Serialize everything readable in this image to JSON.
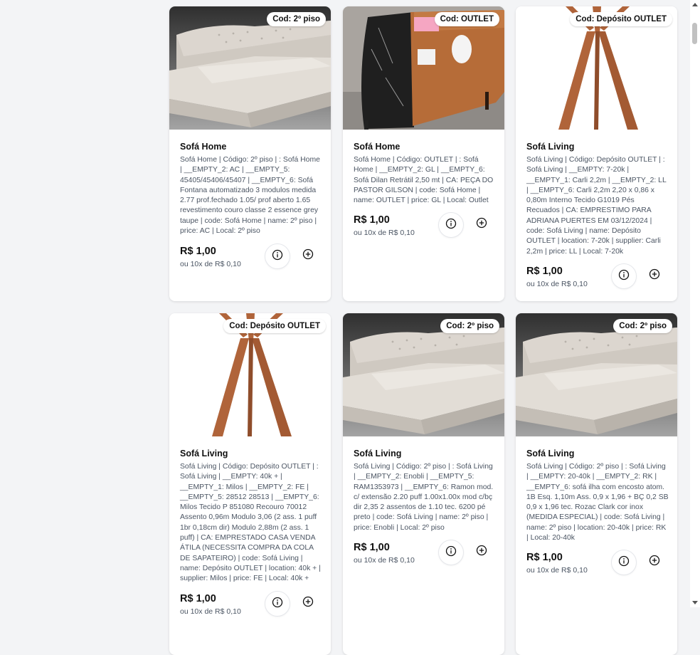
{
  "products": [
    {
      "badge": "Cod: 2º piso",
      "title": "Sofá Home",
      "description": "Sofá Home | Código: 2º piso | : Sofá Home | __EMPTY_2: AC | __EMPTY_5: 45405/45406/45407 | __EMPTY_6: Sofá Fontana automatizado 3 modulos medida 2.77 prof.fechado 1.05/ prof aberto 1.65 revestimento couro classe 2 essence grey taupe | code: Sofá Home | name: 2º piso | price: AC | Local: 2º piso",
      "price": "R$ 1,00",
      "installment": "ou 10x de R$ 0,10",
      "image": "sofa"
    },
    {
      "badge": "Cod: OUTLET",
      "title": "Sofá Home",
      "description": "Sofá Home | Código: OUTLET | : Sofá Home | __EMPTY_2: GL | __EMPTY_6: Sofá Dilan Retrátil 2,50 mt | CA: PEÇA DO PASTOR GILSON | code: Sofá Home | name: OUTLET | price: GL | Local: Outlet",
      "price": "R$ 1,00",
      "installment": "ou 10x de R$ 0,10",
      "image": "table"
    },
    {
      "badge": "Cod: Depósito OUTLET",
      "title": "Sofá Living",
      "description": "Sofá Living | Código: Depósito OUTLET | : Sofá Living | __EMPTY: 7-20k | __EMPTY_1: Carli 2,2m | __EMPTY_2: LL | __EMPTY_6: Carli 2,2m 2,20 x 0,86 x 0,80m Interno Tecido G1019 Pés Recuados | CA: EMPRESTIMO PARA ADRIANA PUERTES EM 03/12/2024 | code: Sofá Living | name: Depósito OUTLET | location: 7-20k | supplier: Carli 2,2m | price: LL | Local: 7-20k",
      "price": "R$ 1,00",
      "installment": "ou 10x de R$ 0,10",
      "image": "legs"
    },
    {
      "badge": "Cod: Depósito OUTLET",
      "title": "Sofá Living",
      "description": "Sofá Living | Código: Depósito OUTLET | : Sofá Living | __EMPTY: 40k + | __EMPTY_1: Milos | __EMPTY_2: FE | __EMPTY_5: 28512 28513 | __EMPTY_6: Milos Tecido P 851080 Recouro 70012 Assento 0,96m Modulo 3,06 (2 ass. 1 puff 1br 0,18cm dir) Modulo 2,88m (2 ass. 1 puff) | CA: EMPRESTADO CASA VENDA ÁTILA (NECESSITA COMPRA DA COLA DE SAPATEIRO) | code: Sofá Living | name: Depósito OUTLET | location: 40k + | supplier: Milos | price: FE | Local: 40k +",
      "price": "R$ 1,00",
      "installment": "ou 10x de R$ 0,10",
      "image": "legs"
    },
    {
      "badge": "Cod: 2º piso",
      "title": "Sofá Living",
      "description": "Sofá Living | Código: 2º piso | : Sofá Living | __EMPTY_2: Enobli | __EMPTY_5: RAM1353973 | __EMPTY_6: Ramon mod. c/ extensão 2.20 puff 1.00x1.00x mod c/bç dir 2,35 2 assentos de 1.10 tec. 6200 pé preto | code: Sofá Living | name: 2º piso | price: Enobli | Local: 2º piso",
      "price": "R$ 1,00",
      "installment": "ou 10x de R$ 0,10",
      "image": "sofa"
    },
    {
      "badge": "Cod: 2º piso",
      "title": "Sofá Living",
      "description": "Sofá Living | Código: 2º piso | : Sofá Living | __EMPTY: 20-40k | __EMPTY_2: RK | __EMPTY_6: sofá ilha com encosto atom. 1B Esq. 1,10m Ass. 0,9 x 1,96 + BÇ 0,2 SB 0,9 x 1,96 tec. Rozac Clark cor inox (MEDIDA ESPECIAL) | code: Sofá Living | name: 2º piso | location: 20-40k | price: RK | Local: 20-40k",
      "price": "R$ 1,00",
      "installment": "ou 10x de R$ 0,10",
      "image": "sofa"
    }
  ],
  "icons": {
    "info": "info-icon",
    "add": "plus-circle-icon"
  },
  "colors": {
    "wood": "#b0643a",
    "sofa": "#d6d0c8",
    "marble": "#1f1f1f"
  }
}
